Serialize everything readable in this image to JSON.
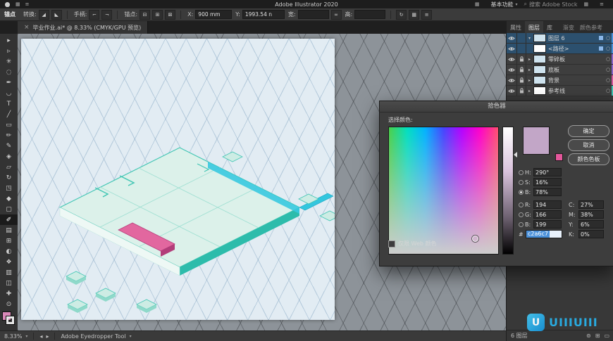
{
  "menu_bar": {
    "app_title": "Adobe Illustrator 2020",
    "workspace_button": "基本功能",
    "search_label": "搜索 Adobe Stock"
  },
  "control_bar": {
    "context_label": "锚点",
    "convert_label": "转换:",
    "handles_label": "手柄:",
    "anchors_label": "锚点:",
    "x_label": "X:",
    "x_value": "900 mm",
    "y_label": "Y:",
    "y_value": "1993.54 n",
    "w_label": "宽:",
    "w_value": "",
    "h_label": "高:",
    "h_value": ""
  },
  "document_tab": {
    "title": "毕业作业.ai* @ 8.33% (CMYK/GPU 预览)"
  },
  "toolbar": {
    "fill_color": "#d989b8",
    "tools": [
      {
        "name": "selection-tool",
        "glyph": "▸"
      },
      {
        "name": "direct-selection-tool",
        "glyph": "▹"
      },
      {
        "name": "magic-wand-tool",
        "glyph": "✳"
      },
      {
        "name": "lasso-tool",
        "glyph": "◌"
      },
      {
        "name": "pen-tool",
        "glyph": "✒"
      },
      {
        "name": "curvature-tool",
        "glyph": "◡"
      },
      {
        "name": "type-tool",
        "glyph": "T"
      },
      {
        "name": "line-segment-tool",
        "glyph": "╱"
      },
      {
        "name": "rectangle-tool",
        "glyph": "▭"
      },
      {
        "name": "paintbrush-tool",
        "glyph": "✏"
      },
      {
        "name": "pencil-tool",
        "glyph": "✎"
      },
      {
        "name": "shaper-tool",
        "glyph": "◈"
      },
      {
        "name": "eraser-tool",
        "glyph": "▱"
      },
      {
        "name": "rotate-tool",
        "glyph": "↻"
      },
      {
        "name": "scale-tool",
        "glyph": "◳"
      },
      {
        "name": "width-tool",
        "glyph": "◆"
      },
      {
        "name": "free-transform-tool",
        "glyph": "▢"
      },
      {
        "name": "eyedropper-tool",
        "glyph": "✐",
        "active": true
      },
      {
        "name": "gradient-tool",
        "glyph": "▤"
      },
      {
        "name": "mesh-tool",
        "glyph": "⊞"
      },
      {
        "name": "blend-tool",
        "glyph": "◐"
      },
      {
        "name": "symbol-sprayer-tool",
        "glyph": "❖"
      },
      {
        "name": "column-graph-tool",
        "glyph": "▥"
      },
      {
        "name": "artboard-tool",
        "glyph": "◫"
      },
      {
        "name": "hand-tool",
        "glyph": "✚"
      },
      {
        "name": "zoom-tool",
        "glyph": "⊙"
      }
    ]
  },
  "canvas": {
    "artboard_color": "#e2ecf3",
    "slab_fill": "#dcf1ea",
    "slab_edge": "#3fc3b2",
    "accent_pink": "#e2679f",
    "accent_cyan": "#38c9e0"
  },
  "color_picker": {
    "title": "拾色器",
    "select_color_label": "选择颜色:",
    "ok_label": "确定",
    "cancel_label": "取消",
    "swatches_label": "颜色色板",
    "web_only_label": "仅限 Web 颜色",
    "preview_color": "#c2a6c7",
    "chip_color": "#e4579b",
    "fields": {
      "h_label": "H:",
      "h_value": "290°",
      "s_label": "S:",
      "s_value": "16%",
      "b_label": "B:",
      "b_value": "78%",
      "r_label": "R:",
      "r_value": "194",
      "g_label": "G:",
      "g_value": "166",
      "b2_label": "B:",
      "b2_value": "199",
      "c_label": "C:",
      "c_value": "27%",
      "m_label": "M:",
      "m_value": "38%",
      "y_label": "Y:",
      "y_value": "6%",
      "k_label": "K:",
      "k_value": "0%",
      "hex_label": "#",
      "hex_value": "c2a6c7"
    }
  },
  "layers_panel": {
    "tabs": [
      {
        "label": "属性"
      },
      {
        "label": "图层"
      },
      {
        "label": "库"
      }
    ],
    "tabs_secondary": [
      {
        "label": "渐变"
      },
      {
        "label": "颜色参考"
      }
    ],
    "rows": [
      {
        "name": "图层 6",
        "color": "#4a90d9"
      },
      {
        "name": "<路径>",
        "color": "#4a90d9"
      },
      {
        "name": "零碎板",
        "color": "#8a63c9"
      },
      {
        "name": "底板",
        "color": "#8a63c9"
      },
      {
        "name": "背景",
        "color": "#d4579e"
      },
      {
        "name": "参考线",
        "color": "#3fc3b2"
      }
    ],
    "footer": {
      "count": "6 图层"
    }
  },
  "status_bar": {
    "zoom": "8.33%",
    "tool_label": "Adobe Eyedropper Tool"
  },
  "watermark": {
    "logo_letter": "U",
    "text": "UIIIUIII"
  },
  "icons": {
    "caret_down": "▾",
    "chevron_right": "▸",
    "chevron_down": "▾",
    "target": "○",
    "panel_menu": "≡",
    "search": "⌕",
    "grid": "▦",
    "close_tab": "×",
    "convert_a": "◢",
    "convert_b": "◣",
    "handle_a": "⌐",
    "handle_b": "¬",
    "anchor_a": "⊞",
    "anchor_b": "⊟",
    "anchor_c": "⊠",
    "link": "∞",
    "transform": "↻",
    "menu": "≡",
    "arrow_left": "◂",
    "arrow_right": "▸",
    "collect": "⊚",
    "new_layer": "⊞",
    "delete_layer": "▭"
  }
}
